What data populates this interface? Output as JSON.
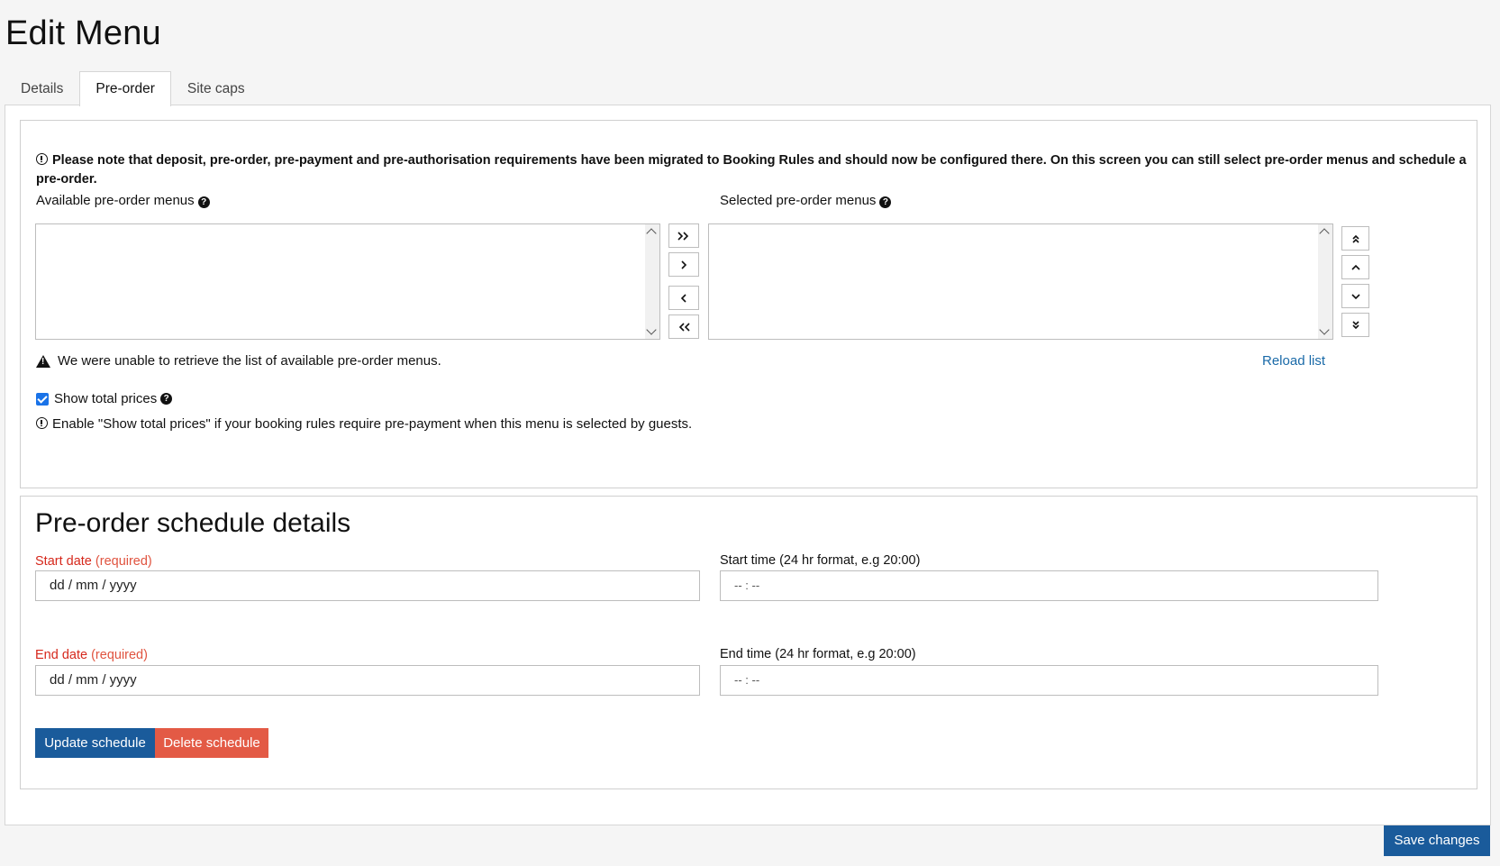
{
  "page": {
    "title": "Edit Menu"
  },
  "tabs": [
    {
      "label": "Details"
    },
    {
      "label": "Pre-order"
    },
    {
      "label": "Site caps"
    }
  ],
  "preorder": {
    "notice": "Please note that deposit, pre-order, pre-payment and pre-authorisation requirements have been migrated to Booking Rules and should now be configured there. On this screen you can still select pre-order menus and schedule a pre-order.",
    "available_label": "Available pre-order menus",
    "selected_label": "Selected pre-order menus",
    "error_message": "We were unable to retrieve the list of available pre-order menus.",
    "reload_link": "Reload list",
    "show_total_prices_label": "Show total prices",
    "show_total_prices_checked": true,
    "hint": "Enable \"Show total prices\" if your booking rules require pre-payment when this menu is selected by guests."
  },
  "schedule": {
    "title": "Pre-order schedule details",
    "start_date_label": "Start date",
    "end_date_label": "End date",
    "required_text": "(required)",
    "start_time_label": "Start time (24 hr format, e.g 20:00)",
    "end_time_label": "End time (24 hr format, e.g 20:00)",
    "date_placeholder": "dd / mm / yyyy",
    "time_placeholder": "-- : --",
    "update_button": "Update schedule",
    "delete_button": "Delete schedule"
  },
  "footer": {
    "save_button": "Save changes"
  },
  "colors": {
    "primary": "#1a5b9b",
    "danger": "#e35a45",
    "required": "#d6281c",
    "link": "#1a6aa8"
  }
}
